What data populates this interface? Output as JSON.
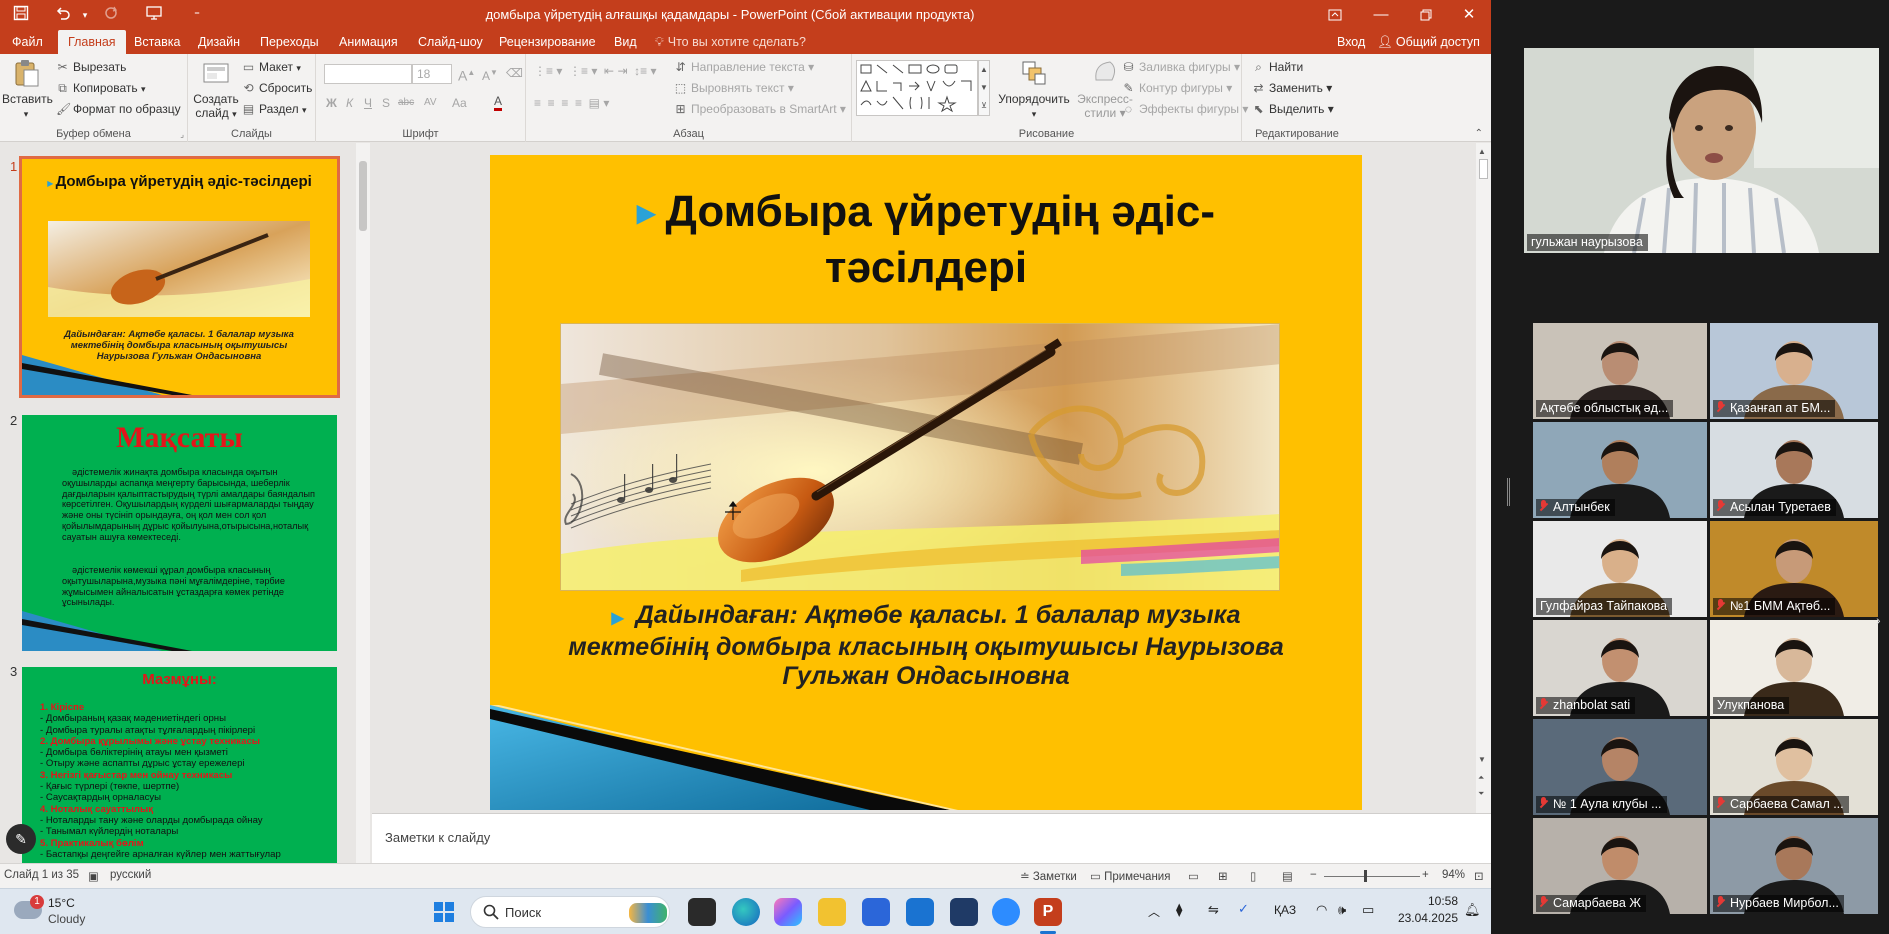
{
  "titlebar": {
    "document_title": "домбыра үйретудің алғашқы қадамдары - PowerPoint (Сбой активации продукта)"
  },
  "menu": {
    "tabs": [
      "Файл",
      "Главная",
      "Вставка",
      "Дизайн",
      "Переходы",
      "Анимация",
      "Слайд-шоу",
      "Рецензирование",
      "Вид"
    ],
    "active_tab": "Главная",
    "tell_me": "Что вы хотите сделать?",
    "login": "Вход",
    "share": "Общий доступ"
  },
  "ribbon": {
    "clipboard": {
      "paste": "Вставить",
      "cut": "Вырезать",
      "copy": "Копировать",
      "format_painter": "Формат по образцу",
      "label": "Буфер обмена"
    },
    "slides": {
      "new_slide_line1": "Создать",
      "new_slide_line2": "слайд",
      "layout": "Макет",
      "reset": "Сбросить",
      "section": "Раздел",
      "label": "Слайды"
    },
    "font": {
      "size": "18",
      "label": "Шрифт",
      "bold": "Ж",
      "italic": "К",
      "underline": "Ч",
      "strike": "S",
      "abc": "abc",
      "spacing": "AV",
      "case": "Aa",
      "color": "A"
    },
    "paragraph": {
      "text_direction": "Направление текста",
      "align_text": "Выровнять текст",
      "smartart": "Преобразовать в SmartArt",
      "label": "Абзац"
    },
    "drawing": {
      "arrange": "Упорядочить",
      "quick_styles_line1": "Экспресс-",
      "quick_styles_line2": "стили",
      "fill": "Заливка фигуры",
      "outline": "Контур фигуры",
      "effects": "Эффекты фигуры",
      "label": "Рисование"
    },
    "editing": {
      "find": "Найти",
      "replace": "Заменить",
      "select": "Выделить",
      "label": "Редактирование"
    }
  },
  "thumbnails": [
    {
      "num": "1",
      "title": "Домбыра үйретудің әдіс-тәсілдері",
      "caption": "Дайындаған: Ақтөбе қаласы. 1 балалар музыка мектебінің домбыра класының оқытушысы Наурызова Гульжан Ондасыновна"
    },
    {
      "num": "2",
      "title": "Мақсаты",
      "body": "әдістемелік жинақта домбыра класында оқытын оқушыларды аспапқа меңгерту барысында, шеберлік дағдыларын қалыптастырудың түрлі амалдары баяндалып көрсетілген. Оқушылардың күрделі шығармаларды тыңдау және оны түсініп орындауға, оң қол мен сол қол қойылымдарының дұрыс қойылуына,отырысына,ноталық сауатын ашуға көмектеседі.",
      "body2": "әдістемелік көмекші құрал домбыра класының оқытушыларына,музыка пәні мұғалімдеріне, тәрбие жұмысымен айналысатын ұстаздарға көмек ретінде ұсынылады."
    },
    {
      "num": "3",
      "title": "Мазмұны:",
      "items": [
        {
          "text": "1.  Кіріспе",
          "red": true
        },
        {
          "text": "-   Домбыраның қазақ мәдениетіндегі орны",
          "red": false
        },
        {
          "text": "-   Домбыра туралы атақты тұлғалардың пікірлері",
          "red": false
        },
        {
          "text": "2.  Домбыра құрылымы және ұстау техникасы",
          "red": true
        },
        {
          "text": "-   Домбыра бөліктерінің атауы мен қызметі",
          "red": false
        },
        {
          "text": "-   Отыру және аспапты дұрыс ұстау ережелері",
          "red": false
        },
        {
          "text": "3.  Негізгі қағыстар мен ойнау техникасы",
          "red": true
        },
        {
          "text": "-   Қағыс түрлері (төкпе, шертпе)",
          "red": false
        },
        {
          "text": "-   Саусақтардың орналасуы",
          "red": false
        },
        {
          "text": "4.  Ноталық сауаттылық",
          "red": true
        },
        {
          "text": "-   Ноталарды тану және оларды домбырада ойнау",
          "red": false
        },
        {
          "text": "-   Танымал күйлердің ноталары",
          "red": false
        },
        {
          "text": "5.  Практикалық бөлім",
          "red": true
        },
        {
          "text": "-   Бастапқы деңгейге арналған күйлер мен жаттығулар",
          "red": false
        }
      ]
    }
  ],
  "slide": {
    "title": "Домбыра үйретудің әдіс-тәсілдері",
    "subtitle": "Дайындаған: Ақтөбе қаласы. 1 балалар музыка мектебінің домбыра класының оқытушысы Наурызова Гульжан Ондасыновна"
  },
  "notes_placeholder": "Заметки к слайду",
  "status": {
    "slide_of": "Слайд 1 из 35",
    "language": "русский",
    "notes": "Заметки",
    "comments": "Примечания",
    "zoom": "94%"
  },
  "taskbar": {
    "weather_temp": "15°C",
    "weather_desc": "Cloudy",
    "weather_badge": "1",
    "search": "Поиск",
    "lang": "ҚАЗ",
    "time": "10:58",
    "date": "23.04.2025"
  },
  "zoom": {
    "speaker": "гульжан наурызова",
    "participants": [
      {
        "name": "Ақтөбе облыстық әд...",
        "muted": false
      },
      {
        "name": "Қазанғап ат БМ...",
        "muted": true
      },
      {
        "name": "Алтынбек",
        "muted": true
      },
      {
        "name": "Асылан Туретаев",
        "muted": true
      },
      {
        "name": "Гулфайраз Тайпакова",
        "muted": false
      },
      {
        "name": "№1 БММ  Ақтөб...",
        "muted": true
      },
      {
        "name": "zhanbolat sati",
        "muted": true
      },
      {
        "name": "Улукпанова",
        "muted": false
      },
      {
        "name": "№ 1 Аула клубы ...",
        "muted": true
      },
      {
        "name": "Сарбаева Самал ...",
        "muted": true
      },
      {
        "name": "Самарбаева Ж",
        "muted": true
      },
      {
        "name": "Нурбаев Мирбол...",
        "muted": true
      }
    ]
  },
  "colors": {
    "accent": "#c43e1c",
    "slide_bg": "#ffc000",
    "slide2_bg": "#00b050",
    "bullet": "#2aa2d6"
  }
}
